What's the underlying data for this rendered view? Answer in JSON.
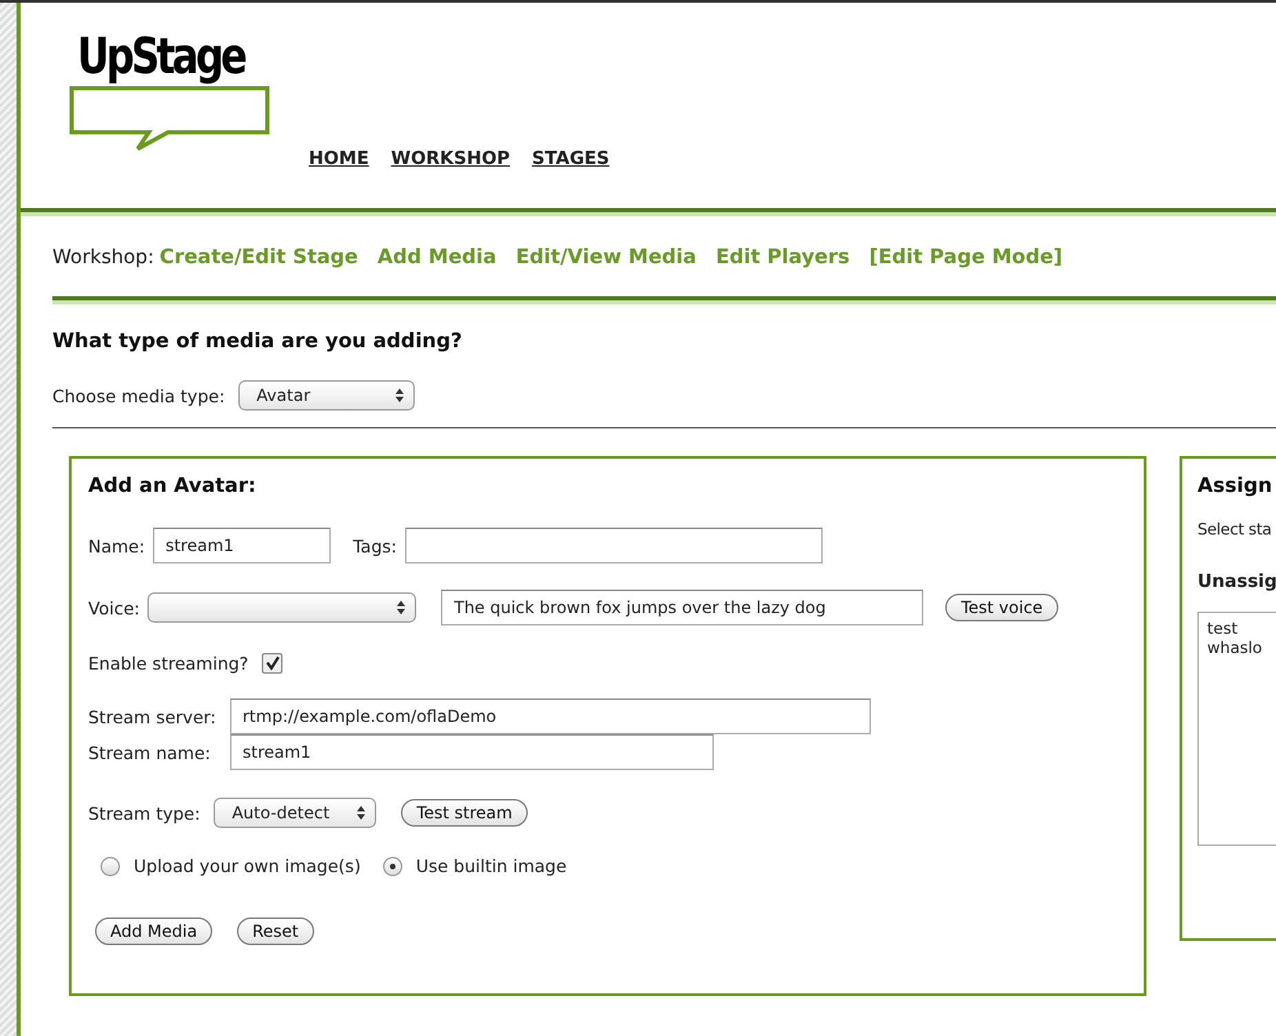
{
  "logo": "UpStage",
  "nav": [
    {
      "label": "HOME"
    },
    {
      "label": "WORKSHOP"
    },
    {
      "label": "STAGES"
    }
  ],
  "workshop": {
    "label": "Workshop:",
    "links": [
      {
        "label": "Create/Edit Stage"
      },
      {
        "label": "Add Media"
      },
      {
        "label": "Edit/View Media"
      },
      {
        "label": "Edit Players"
      },
      {
        "label": "[Edit Page Mode]"
      }
    ]
  },
  "heading": "What type of media are you adding?",
  "media_type": {
    "label": "Choose media type:",
    "value": "Avatar"
  },
  "avatar_form": {
    "title": "Add an Avatar:",
    "name": {
      "label": "Name:",
      "value": "stream1"
    },
    "tags": {
      "label": "Tags:"
    },
    "voice": {
      "label": "Voice:",
      "text": "The quick brown fox jumps over the lazy dog",
      "button": "Test voice"
    },
    "streaming": {
      "label": "Enable streaming?",
      "checked": true
    },
    "stream_server": {
      "label": "Stream server:",
      "value": "rtmp://example.com/oflaDemo"
    },
    "stream_name": {
      "label": "Stream name:",
      "value": "stream1"
    },
    "stream_type": {
      "label": "Stream type:",
      "value": "Auto-detect",
      "button": "Test stream"
    },
    "image_options": [
      {
        "label": "Upload your own image(s)",
        "selected": false
      },
      {
        "label": "Use builtin image",
        "selected": true
      }
    ],
    "buttons": [
      "Add Media",
      "Reset"
    ]
  },
  "assign_panel": {
    "title": "Assign",
    "select_label": "Select sta",
    "list_title": "Unassig",
    "stages": [
      "test",
      "whaslo"
    ]
  }
}
